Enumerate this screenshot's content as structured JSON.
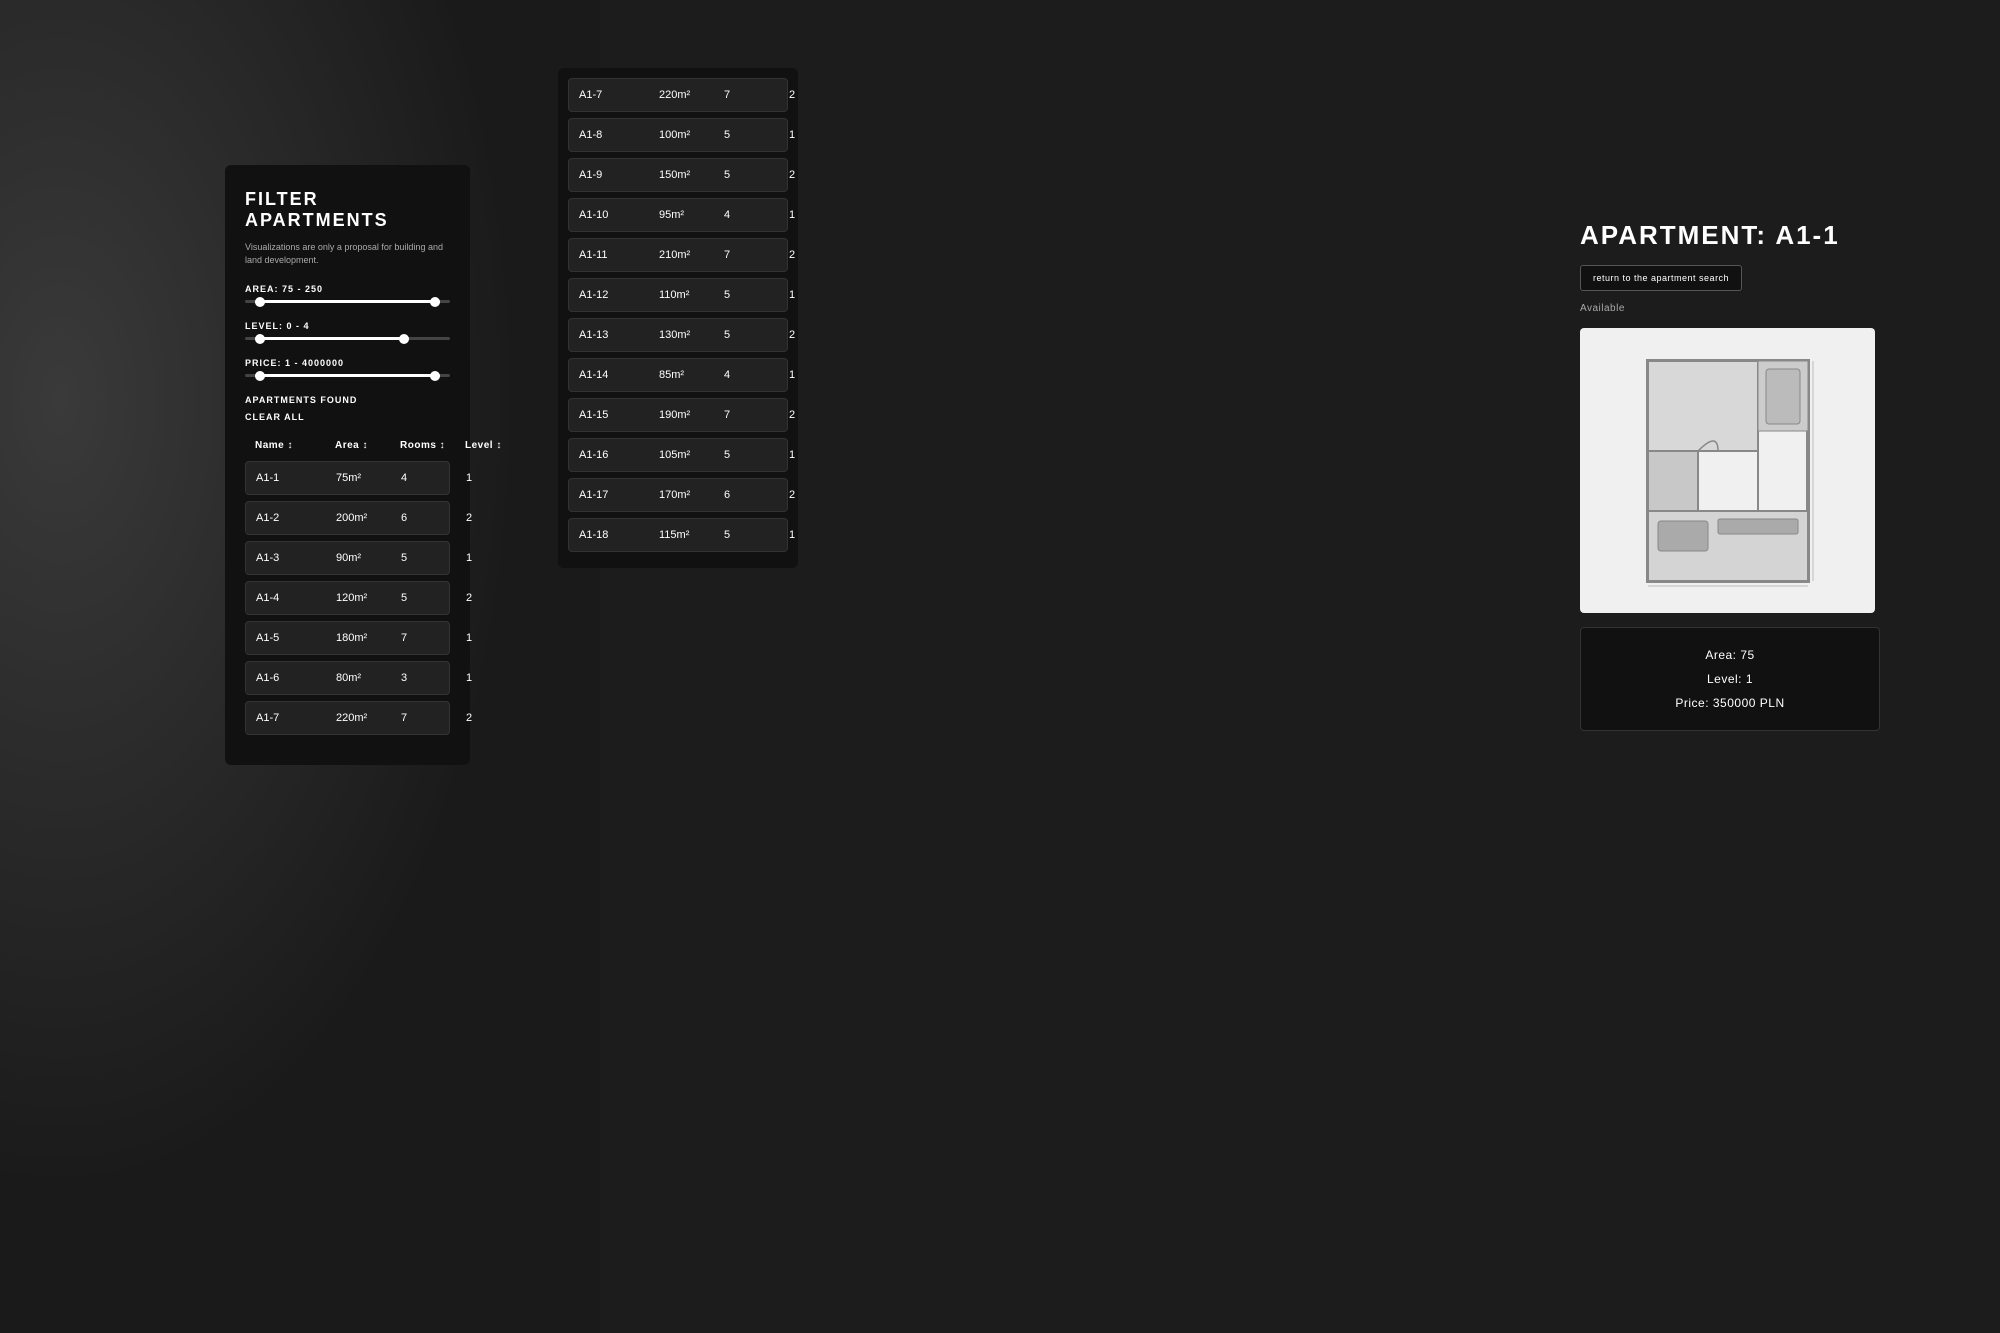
{
  "background": {
    "color": "#1c1c1c"
  },
  "filter_panel": {
    "title": "FILTER APARTMENTS",
    "subtitle": "Visualizations are only a proposal for building and land development.",
    "area_label": "AREA:  75  -  250",
    "level_label": "LEVEL:  0  -  4",
    "price_label": "PRICE:  1  -  4000000",
    "apartments_found": "APARTMENTS FOUND",
    "clear_all": "CLEAR ALL",
    "table_headers": {
      "name": "Name ↕",
      "area": "Area ↕",
      "rooms": "Rooms ↕",
      "level": "Level ↕"
    },
    "apartments": [
      {
        "name": "A1-1",
        "area": "75m²",
        "rooms": "4",
        "level": "1"
      },
      {
        "name": "A1-2",
        "area": "200m²",
        "rooms": "6",
        "level": "2"
      },
      {
        "name": "A1-3",
        "area": "90m²",
        "rooms": "5",
        "level": "1"
      },
      {
        "name": "A1-4",
        "area": "120m²",
        "rooms": "5",
        "level": "2"
      },
      {
        "name": "A1-5",
        "area": "180m²",
        "rooms": "7",
        "level": "1"
      },
      {
        "name": "A1-6",
        "area": "80m²",
        "rooms": "3",
        "level": "1"
      },
      {
        "name": "A1-7",
        "area": "220m²",
        "rooms": "7",
        "level": "2"
      }
    ]
  },
  "middle_list": {
    "apartments": [
      {
        "name": "A1-7",
        "area": "220m²",
        "rooms": "7",
        "level": "2"
      },
      {
        "name": "A1-8",
        "area": "100m²",
        "rooms": "5",
        "level": "1"
      },
      {
        "name": "A1-9",
        "area": "150m²",
        "rooms": "5",
        "level": "2"
      },
      {
        "name": "A1-10",
        "area": "95m²",
        "rooms": "4",
        "level": "1"
      },
      {
        "name": "A1-11",
        "area": "210m²",
        "rooms": "7",
        "level": "2"
      },
      {
        "name": "A1-12",
        "area": "110m²",
        "rooms": "5",
        "level": "1"
      },
      {
        "name": "A1-13",
        "area": "130m²",
        "rooms": "5",
        "level": "2"
      },
      {
        "name": "A1-14",
        "area": "85m²",
        "rooms": "4",
        "level": "1"
      },
      {
        "name": "A1-15",
        "area": "190m²",
        "rooms": "7",
        "level": "2"
      },
      {
        "name": "A1-16",
        "area": "105m²",
        "rooms": "5",
        "level": "1"
      },
      {
        "name": "A1-17",
        "area": "170m²",
        "rooms": "6",
        "level": "2"
      },
      {
        "name": "A1-18",
        "area": "115m²",
        "rooms": "5",
        "level": "1"
      }
    ]
  },
  "detail_panel": {
    "title": "APARTMENT: A1-1",
    "return_btn": "return to the apartment search",
    "available": "Available",
    "area": "Area: 75",
    "level": "Level: 1",
    "price": "Price: 350000 PLN"
  }
}
